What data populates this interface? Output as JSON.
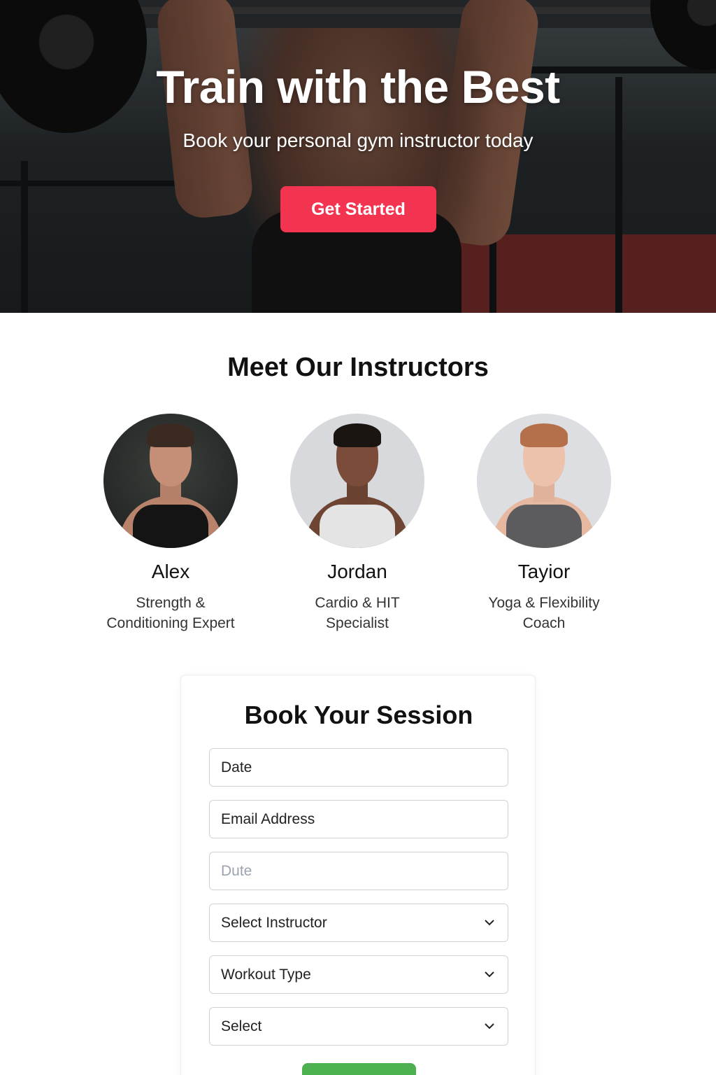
{
  "hero": {
    "title": "Train with the Best",
    "subtitle": "Book your personal gym instructor today",
    "cta_label": "Get Started",
    "cta_color": "#f23451"
  },
  "instructors": {
    "title": "Meet Our Instructors",
    "items": [
      {
        "name": "Alex",
        "role_line1": "Strength &",
        "role_line2": "Conditioning Expert"
      },
      {
        "name": "Jordan",
        "role_line1": "Cardio & HIT",
        "role_line2": "Specialist"
      },
      {
        "name": "Tayior",
        "role_line1": "Yoga & Flexibility",
        "role_line2": "Coach"
      }
    ]
  },
  "booking": {
    "title": "Book Your Session",
    "fields": [
      {
        "label": "Date",
        "type": "input"
      },
      {
        "label": "Email Address",
        "type": "input"
      },
      {
        "label": "Dute",
        "type": "input-placeholder"
      },
      {
        "label": "Select Instructor",
        "type": "select",
        "icon": "chevron-down-icon"
      },
      {
        "label": "Workout Type",
        "type": "select",
        "icon": "chevron-down-icon"
      },
      {
        "label": "Select",
        "type": "select",
        "icon": "chevron-down-icon"
      }
    ],
    "submit_color": "#4caf50"
  }
}
